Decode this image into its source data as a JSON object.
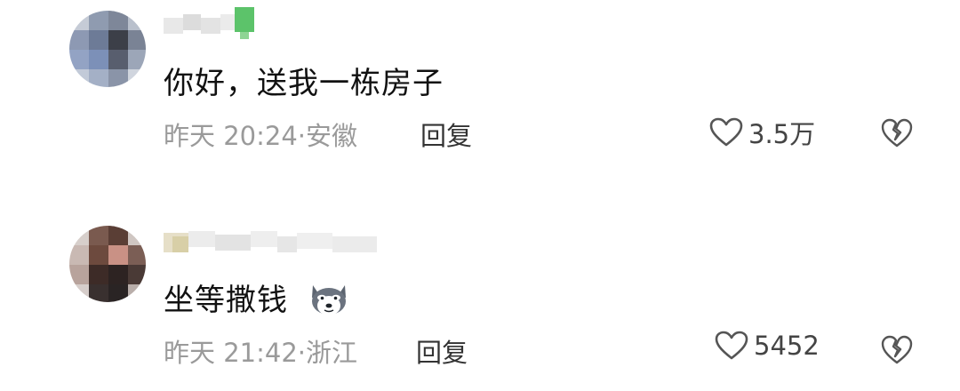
{
  "comments": [
    {
      "text": "你好，送我一栋房子",
      "time": "昨天 20:24",
      "location": "安徽",
      "reply_label": "回复",
      "likes": "3.5万"
    },
    {
      "text": "坐等撒钱",
      "time": "昨天 21:42",
      "location": "浙江",
      "reply_label": "回复",
      "likes": "5452",
      "emoji": "husky-dog-emoji"
    }
  ],
  "icons": {
    "like": "heart-outline-icon",
    "dislike": "broken-heart-icon"
  },
  "colors": {
    "text": "#111111",
    "meta": "#9a9a9a",
    "badge": "#5cc36a"
  }
}
